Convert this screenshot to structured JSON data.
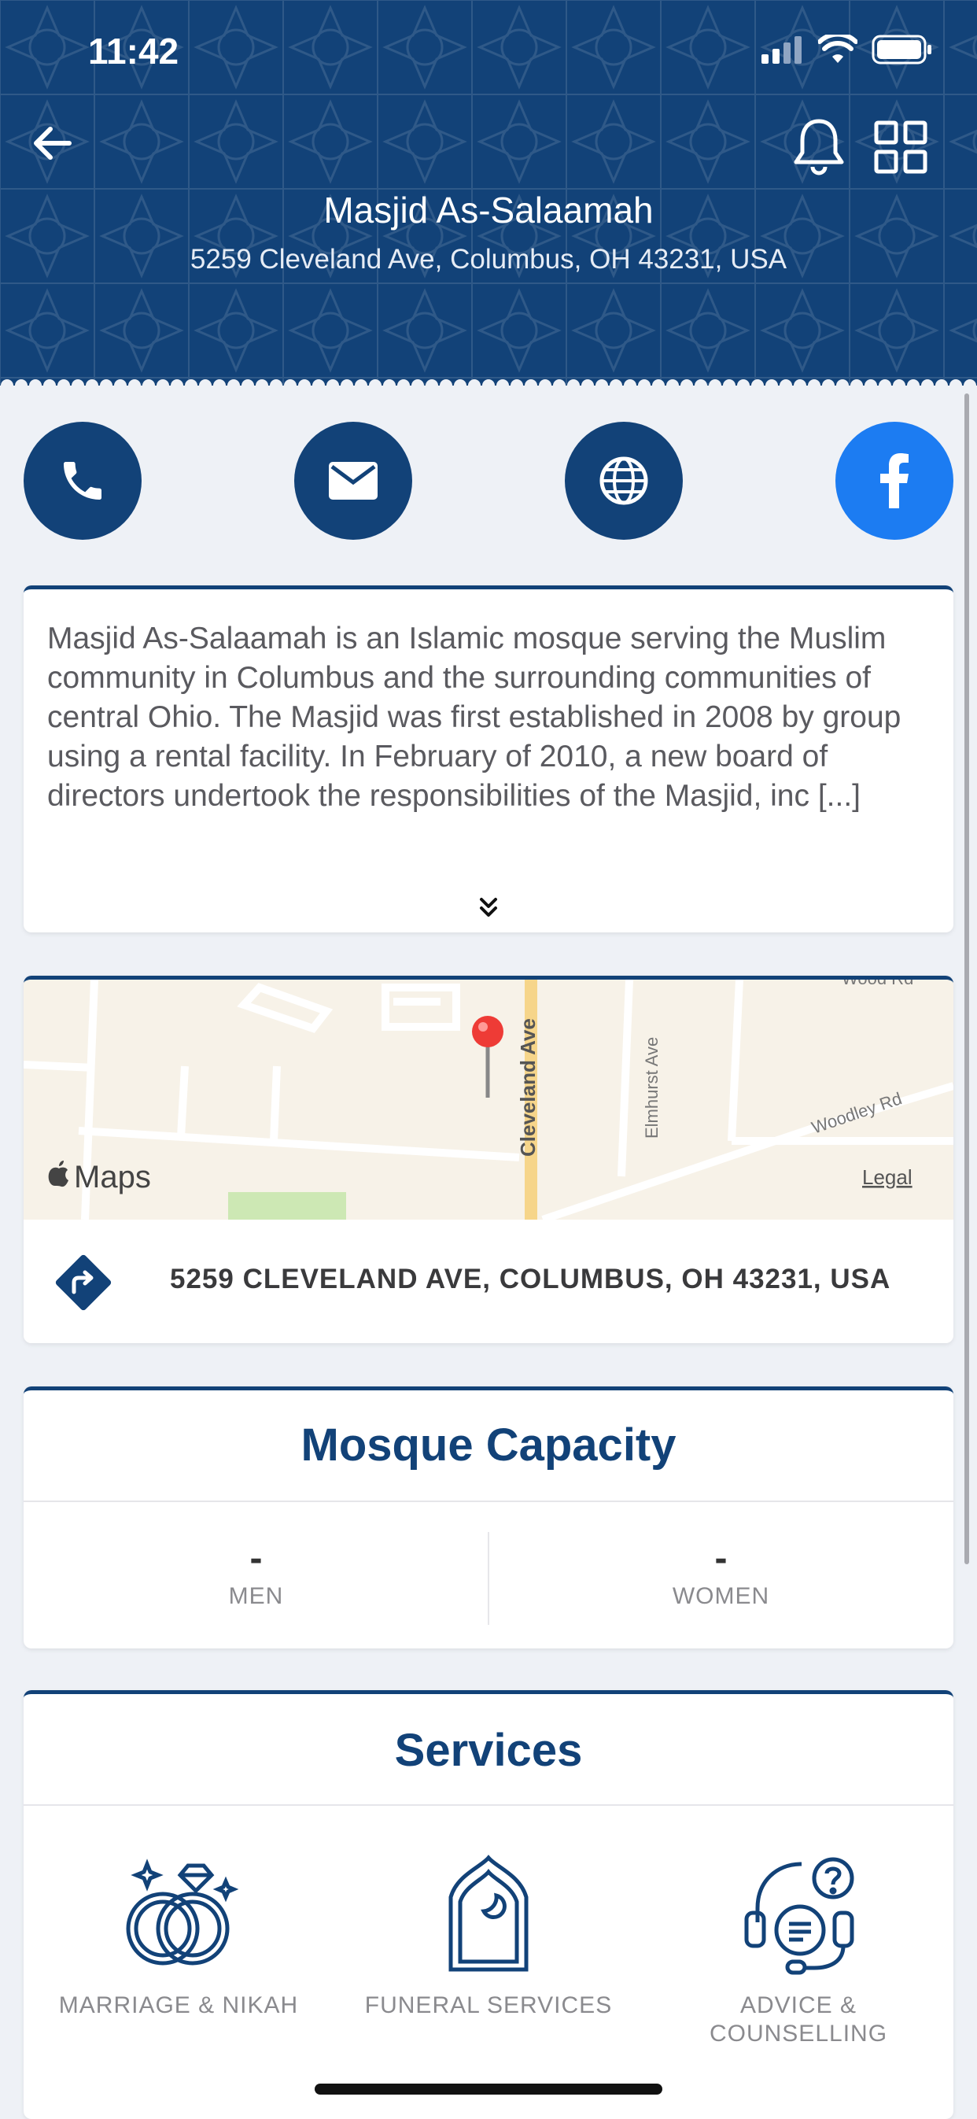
{
  "status_bar": {
    "time": "11:42"
  },
  "header": {
    "title": "Masjid As-Salaamah",
    "address": "5259 Cleveland Ave, Columbus, OH 43231, USA"
  },
  "contact": [
    {
      "name": "phone-icon"
    },
    {
      "name": "email-icon"
    },
    {
      "name": "website-icon"
    },
    {
      "name": "facebook-icon"
    }
  ],
  "description": {
    "text": "Masjid As-Salaamah is an Islamic mosque serving the Muslim community in Columbus and the surrounding communities of central Ohio. The Masjid was first established in 2008 by group using a rental facility. In February of 2010, a new board of directors undertook the responsibilities of the Masjid, inc [...]"
  },
  "map": {
    "street_main": "Cleveland Ave",
    "street_2": "Elmhurst Ave",
    "street_3": "Woodley Rd",
    "street_4": "Wood Rd",
    "brand": "Maps",
    "legal": "Legal",
    "address": "5259 CLEVELAND AVE, COLUMBUS, OH 43231, USA"
  },
  "capacity": {
    "title": "Mosque Capacity",
    "men_value": "-",
    "men_label": "MEN",
    "women_value": "-",
    "women_label": "WOMEN"
  },
  "services": {
    "title": "Services",
    "items": [
      {
        "label": "MARRIAGE & NIKAH",
        "icon": "rings-icon"
      },
      {
        "label": "FUNERAL SERVICES",
        "icon": "mihrab-icon"
      },
      {
        "label": "ADVICE &\nCOUNSELLING",
        "icon": "headset-icon"
      }
    ]
  },
  "colors": {
    "primary": "#124278",
    "facebook": "#1c7cf2",
    "background": "#eef1f6"
  }
}
